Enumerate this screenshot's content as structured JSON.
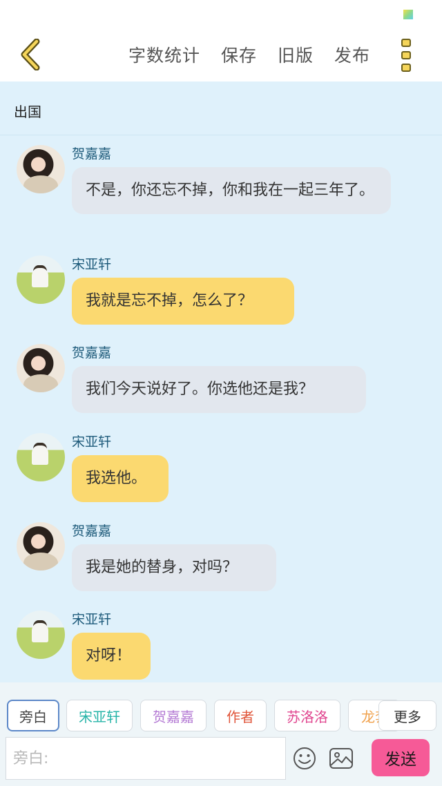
{
  "toolbar": {
    "actions": [
      "字数统计",
      "保存",
      "旧版",
      "发布"
    ]
  },
  "chapter_title": "出国",
  "messages": [
    {
      "speaker": "贺嘉嘉",
      "text": "不是，你还忘不掉，你和我在一起三年了。",
      "style": "gray"
    },
    {
      "speaker": "宋亚轩",
      "text": "我就是忘不掉，怎么了？",
      "style": "yellow"
    },
    {
      "speaker": "贺嘉嘉",
      "text": "我们今天说好了。你选他还是我？",
      "style": "gray"
    },
    {
      "speaker": "宋亚轩",
      "text": "我选他。",
      "style": "yellow"
    },
    {
      "speaker": "贺嘉嘉",
      "text": "我是她的替身，对吗？",
      "style": "gray"
    },
    {
      "speaker": "宋亚轩",
      "text": "对呀！",
      "style": "yellow"
    }
  ],
  "roles": [
    {
      "label": "旁白",
      "color": "#555555"
    },
    {
      "label": "宋亚轩",
      "color": "#27b4a8"
    },
    {
      "label": "贺嘉嘉",
      "color": "#b47ad4"
    },
    {
      "label": "作者",
      "color": "#e0553a"
    },
    {
      "label": "苏洛洛",
      "color": "#e0458f"
    },
    {
      "label": "龙套",
      "color": "#f0a04a"
    }
  ],
  "more_roles_label": "更多",
  "input": {
    "placeholder": "旁白:"
  },
  "send_label": "发送",
  "icons": {
    "back": "chevron-left-icon",
    "menu": "more-vertical-icon",
    "emoji": "smiley-icon",
    "image": "image-icon"
  },
  "colors": {
    "accent_yellow": "#fbd970",
    "send_pink": "#f65a97",
    "chat_background": "#dff1fb"
  }
}
